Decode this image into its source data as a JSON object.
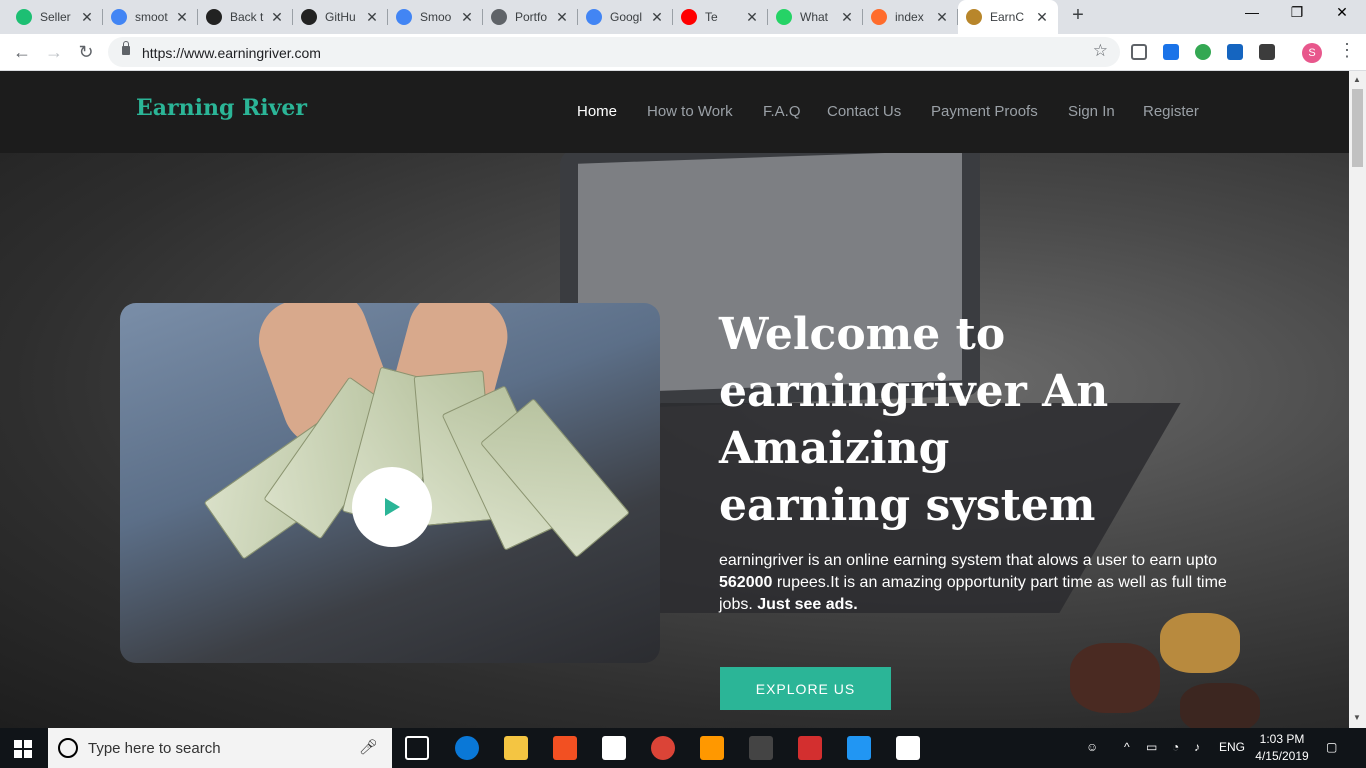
{
  "browser": {
    "tabs": [
      {
        "title": "Seller",
        "icon": "fiverr-icon",
        "color": "#1dbf73"
      },
      {
        "title": "smoot",
        "icon": "google-icon",
        "color": "#4285f4"
      },
      {
        "title": "Back t",
        "icon": "app-icon",
        "color": "#222222"
      },
      {
        "title": "GitHu",
        "icon": "github-icon",
        "color": "#222222"
      },
      {
        "title": "Smoo",
        "icon": "loading-icon",
        "color": "#4285f4"
      },
      {
        "title": "Portfo",
        "icon": "page-icon",
        "color": "#5f6368"
      },
      {
        "title": "Googl",
        "icon": "google-icon",
        "color": "#4285f4"
      },
      {
        "title": "Te",
        "icon": "youtube-icon",
        "color": "#ff0000"
      },
      {
        "title": "What",
        "icon": "whatsapp-icon",
        "color": "#25d366"
      },
      {
        "title": "index",
        "icon": "cpanel-icon",
        "color": "#ff6c2c"
      },
      {
        "title": "EarnC",
        "icon": "site-icon",
        "color": "#b8862b"
      }
    ],
    "new_tab": "+",
    "window_controls": {
      "minimize": "—",
      "restore": "❐",
      "close": "✕"
    },
    "url": "https://www.earningriver.com",
    "profile_initial": "S"
  },
  "site": {
    "brand": "Earning River",
    "nav": [
      {
        "label": "Home",
        "active": true
      },
      {
        "label": "How to Work"
      },
      {
        "label": "F.A.Q"
      },
      {
        "label": "Contact Us"
      },
      {
        "label": "Payment Proofs"
      },
      {
        "label": "Sign In"
      },
      {
        "label": "Register"
      }
    ],
    "hero": {
      "headline": "Welcome to earningriver An Amaizing earning system",
      "desc_part1": "earningriver is an online earning system that alows a user to earn upto ",
      "desc_bold1": "562000",
      "desc_part2": " rupees.It is an amazing opportunity part time as well as full time jobs. ",
      "desc_bold2": "Just see ads.",
      "cta": "EXPLORE US"
    }
  },
  "taskbar": {
    "search_placeholder": "Type here to search",
    "lang": "ENG",
    "time": "1:03 PM",
    "date": "4/15/2019"
  },
  "colors": {
    "accent": "#2bb597",
    "nav_bg": "#1c1c1c"
  }
}
